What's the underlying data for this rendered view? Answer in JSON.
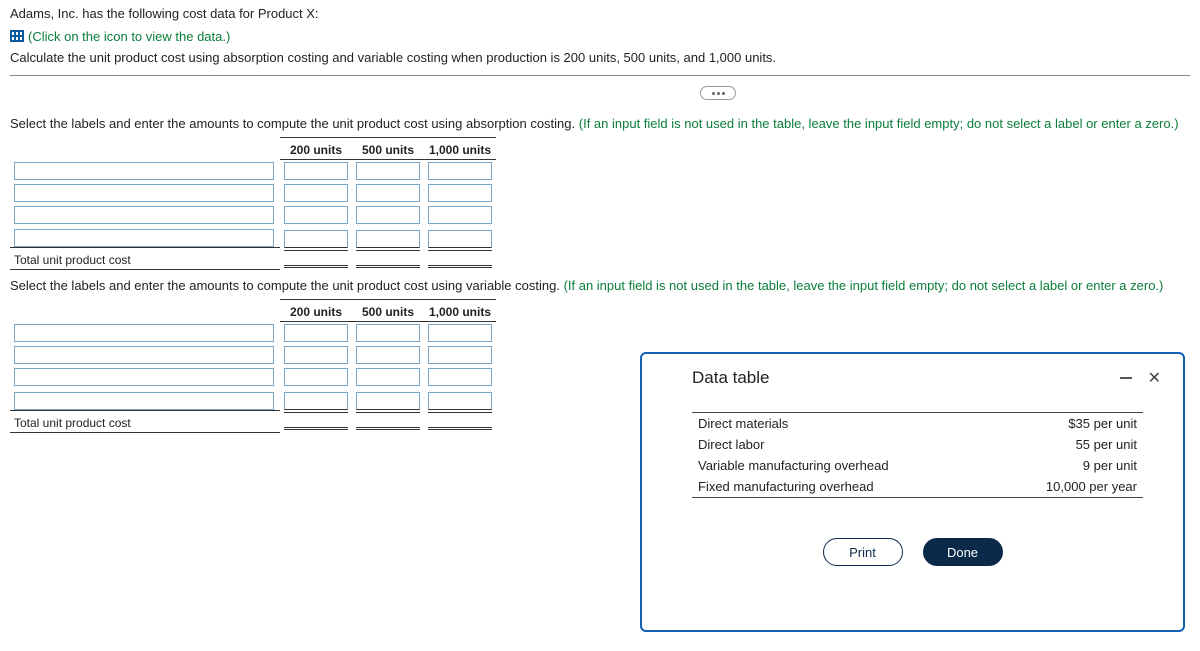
{
  "intro": {
    "line1": "Adams, Inc. has the following cost data for Product X:",
    "icon_link": "(Click on the icon to view the data.)",
    "calc_line": "Calculate the unit product cost using absorption costing and variable costing when production is 200 units, 500 units, and 1,000 units."
  },
  "absorption": {
    "prompt_main": "Select the labels and enter the amounts to compute the unit product cost using absorption costing. ",
    "prompt_hint": "(If an input field is not used in the table, leave the input field empty; do not select a label or enter a zero.)",
    "cols": [
      "200 units",
      "500 units",
      "1,000 units"
    ],
    "total_label": "Total unit product cost"
  },
  "variable": {
    "prompt_main": "Select the labels and enter the amounts to compute the unit product cost using variable costing. ",
    "prompt_hint": "(If an input field is not used in the table, leave the input field empty; do not select a label or enter a zero.)",
    "cols": [
      "200 units",
      "500 units",
      "1,000 units"
    ],
    "total_label": "Total unit product cost"
  },
  "modal": {
    "title": "Data table",
    "rows": [
      {
        "label": "Direct materials",
        "value": "$35 per unit"
      },
      {
        "label": "Direct labor",
        "value": "55 per unit"
      },
      {
        "label": "Variable manufacturing overhead",
        "value": "9 per unit"
      },
      {
        "label": "Fixed manufacturing overhead",
        "value": "10,000 per year"
      }
    ],
    "print": "Print",
    "done": "Done"
  }
}
